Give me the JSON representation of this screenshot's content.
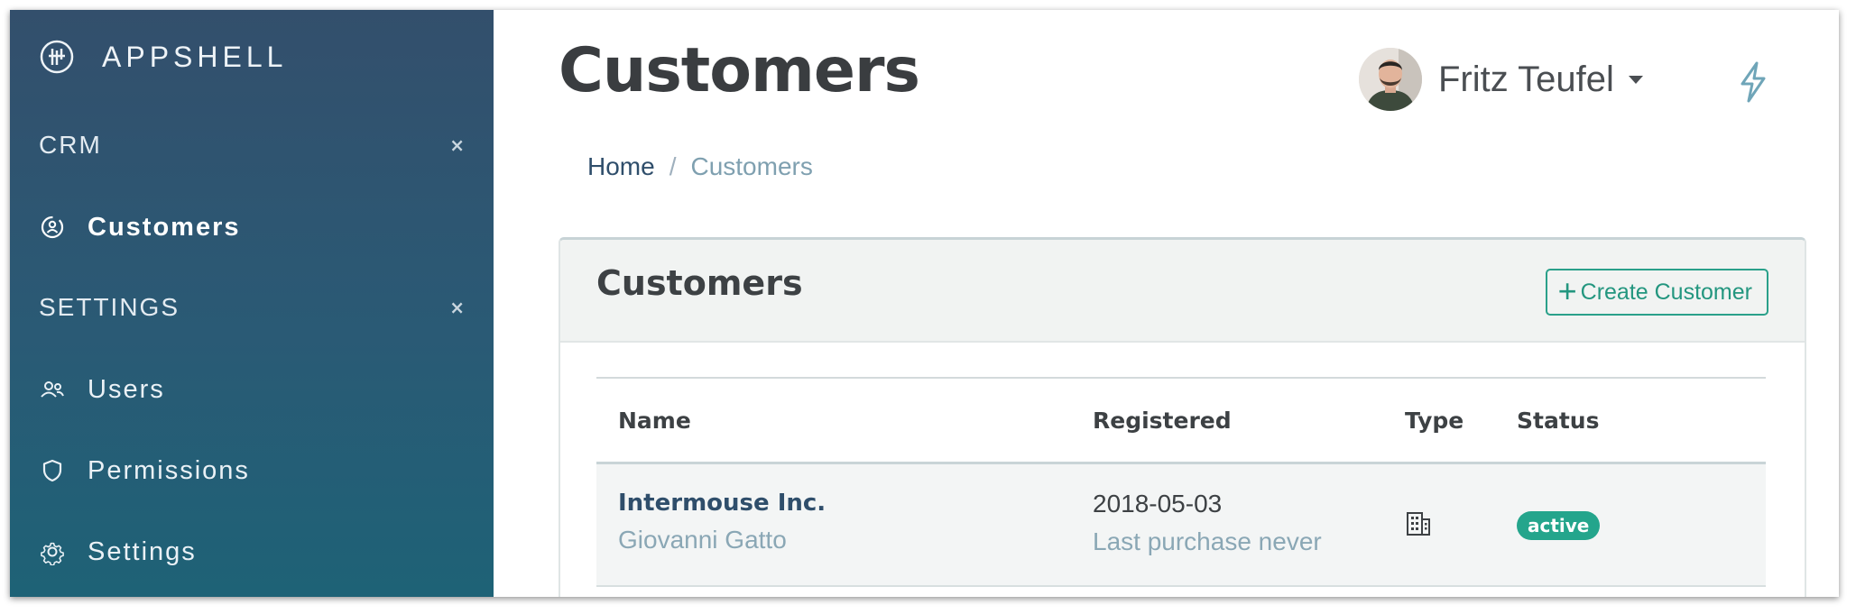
{
  "brand": {
    "name": "APPSHELL",
    "icon": "brand-logo-icon"
  },
  "sidebar": {
    "sections": [
      {
        "label": "CRM",
        "toggle": "×",
        "items": [
          {
            "label": "Customers",
            "icon": "customers-icon",
            "active": true
          }
        ]
      },
      {
        "label": "SETTINGS",
        "toggle": "×",
        "items": [
          {
            "label": "Users",
            "icon": "users-icon"
          },
          {
            "label": "Permissions",
            "icon": "shield-icon"
          },
          {
            "label": "Settings",
            "icon": "gear-icon"
          }
        ]
      }
    ]
  },
  "header": {
    "title": "Customers",
    "user": {
      "name": "Fritz Teufel"
    },
    "action_icon": "bolt-icon"
  },
  "breadcrumb": {
    "home": "Home",
    "separator": "/",
    "current": "Customers"
  },
  "card": {
    "title": "Customers",
    "create_button": {
      "icon": "+",
      "label": "Create Customer"
    }
  },
  "table": {
    "columns": [
      "Name",
      "Registered",
      "Type",
      "Status"
    ],
    "rows": [
      {
        "name": "Intermouse Inc.",
        "contact": "Giovanni Gatto",
        "registered": "2018-05-03",
        "last_purchase": "Last purchase never",
        "type_icon": "building-icon",
        "status": "active"
      }
    ]
  },
  "colors": {
    "sidebar_top": "#334f6c",
    "sidebar_bottom": "#1e6276",
    "accent": "#24a58c",
    "link": "#2f4e6b",
    "muted": "#8aa7b5"
  }
}
